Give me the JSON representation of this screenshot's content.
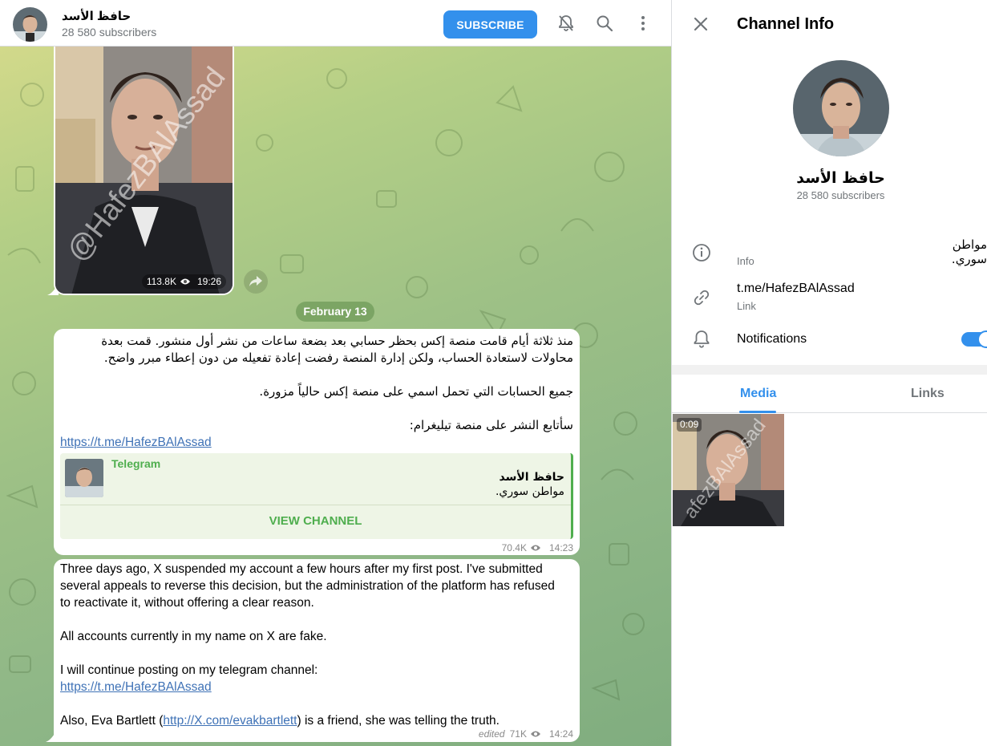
{
  "header": {
    "title": "حافظ الأسد",
    "subtitle": "28 580 subscribers",
    "subscribe_label": "SUBSCRIBE"
  },
  "video_message": {
    "watermark": "@HafezBAlAssad",
    "views": "113.8K",
    "time": "19:26"
  },
  "date_divider": "February 13",
  "message_ar": {
    "line1": "منذ ثلاثة أيام قامت منصة إكس بحظر حسابي بعد بضعة ساعات من نشر أول منشور. قمت بعدة",
    "line2": "محاولات لاستعادة الحساب، ولكن إدارة المنصة رفضت إعادة تفعيله من دون إعطاء مبرر واضح.",
    "line3": "جميع الحسابات التي تحمل اسمي على منصة إكس حالياً مزورة.",
    "line4": "سأتابع النشر على منصة تيليغرام:",
    "link": "https://t.me/HafezBAlAssad",
    "preview": {
      "site": "Telegram",
      "title": "حافظ الأسد",
      "description": "مواطن سوري.",
      "button": "VIEW CHANNEL"
    },
    "views": "70.4K",
    "time": "14:23"
  },
  "message_en": {
    "line1": "Three days ago, X suspended my account a few hours after my first post. I've submitted",
    "line2": "several appeals to reverse this decision, but the administration of the platform has refused",
    "line3": "to reactivate it, without offering a clear reason.",
    "line4": "All accounts currently in my name on X are fake.",
    "line5": "I will continue posting on my telegram channel:",
    "link": "https://t.me/HafezBAlAssad",
    "line6_pre": "Also, Eva Bartlett (",
    "line6_link": "http://X.com/evakbartlett",
    "line6_post": ") is a friend, she was telling the truth.",
    "edited": "edited",
    "views": "71K",
    "time": "14:24"
  },
  "panel": {
    "title": "Channel Info",
    "name": "حافظ الأسد",
    "subscribers": "28 580 subscribers",
    "info_value": "مواطن سوري.",
    "info_label": "Info",
    "link_value": "t.me/HafezBAlAssad",
    "link_label": "Link",
    "notifications_label": "Notifications",
    "notifications_on": true,
    "tabs": [
      "Media",
      "Links"
    ],
    "media_duration": "0:09"
  },
  "colors": {
    "accent": "#3390ec",
    "preview_green": "#4fae4e",
    "link": "#3f72b6"
  },
  "icons": [
    "mute-bell-icon",
    "search-icon",
    "more-vertical-icon",
    "close-icon",
    "info-icon",
    "link-icon",
    "bell-icon",
    "eye-icon",
    "share-icon"
  ]
}
